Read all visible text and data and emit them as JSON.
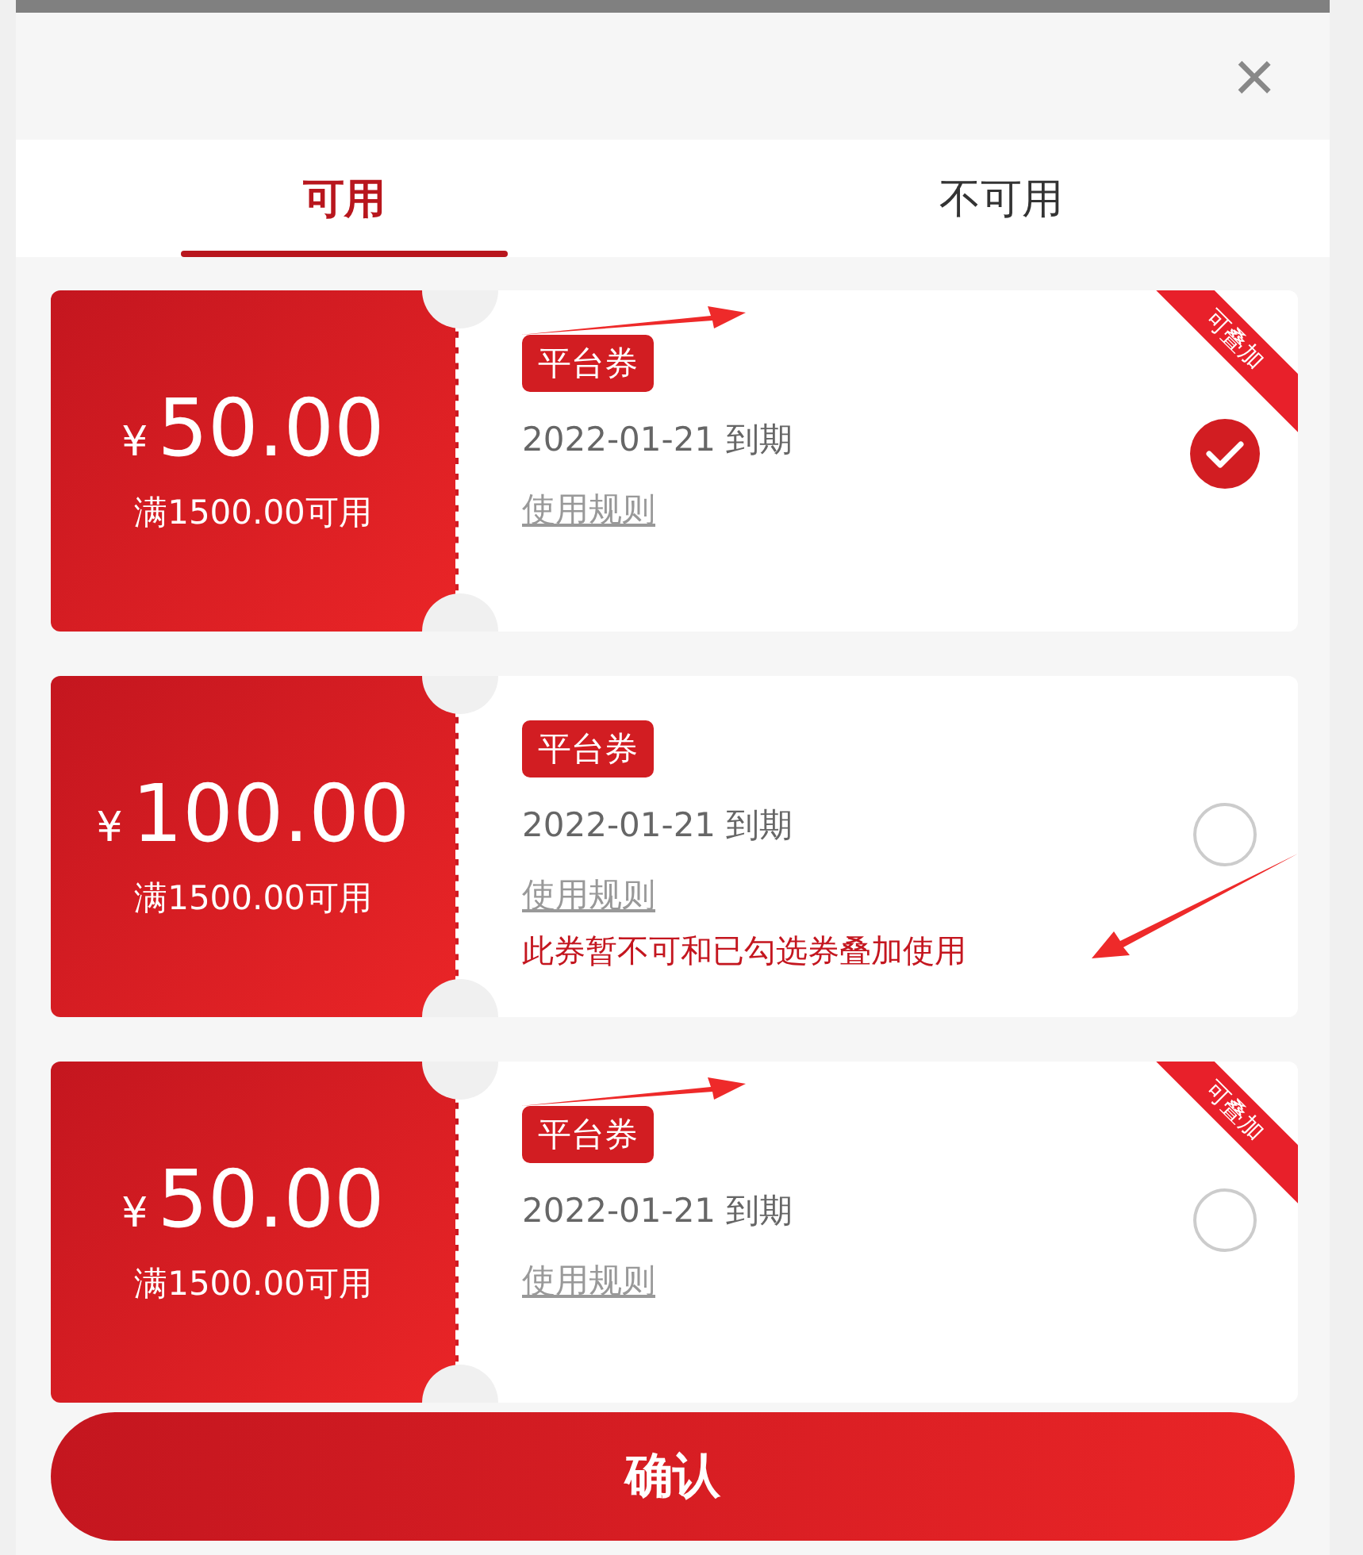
{
  "close_label": "×",
  "tabs": [
    {
      "label": "可用",
      "selected": true
    },
    {
      "label": "不可用",
      "selected": false
    }
  ],
  "coupons": [
    {
      "currency": "¥",
      "amount": "50.00",
      "condition": "满1500.00可用",
      "tag": "平台券",
      "expiry": "2022-01-21 到期",
      "rules_link": "使用规则",
      "ribbon": "可叠加",
      "selected": true,
      "arrow": true
    },
    {
      "currency": "¥",
      "amount": "100.00",
      "condition": "满1500.00可用",
      "tag": "平台券",
      "expiry": "2022-01-21 到期",
      "rules_link": "使用规则",
      "warning": "此券暂不可和已勾选券叠加使用",
      "selected": false,
      "arrow": true
    },
    {
      "currency": "¥",
      "amount": "50.00",
      "condition": "满1500.00可用",
      "tag": "平台券",
      "expiry": "2022-01-21 到期",
      "rules_link": "使用规则",
      "ribbon": "可叠加",
      "selected": false,
      "arrow": true
    }
  ],
  "confirm_button": "确认"
}
